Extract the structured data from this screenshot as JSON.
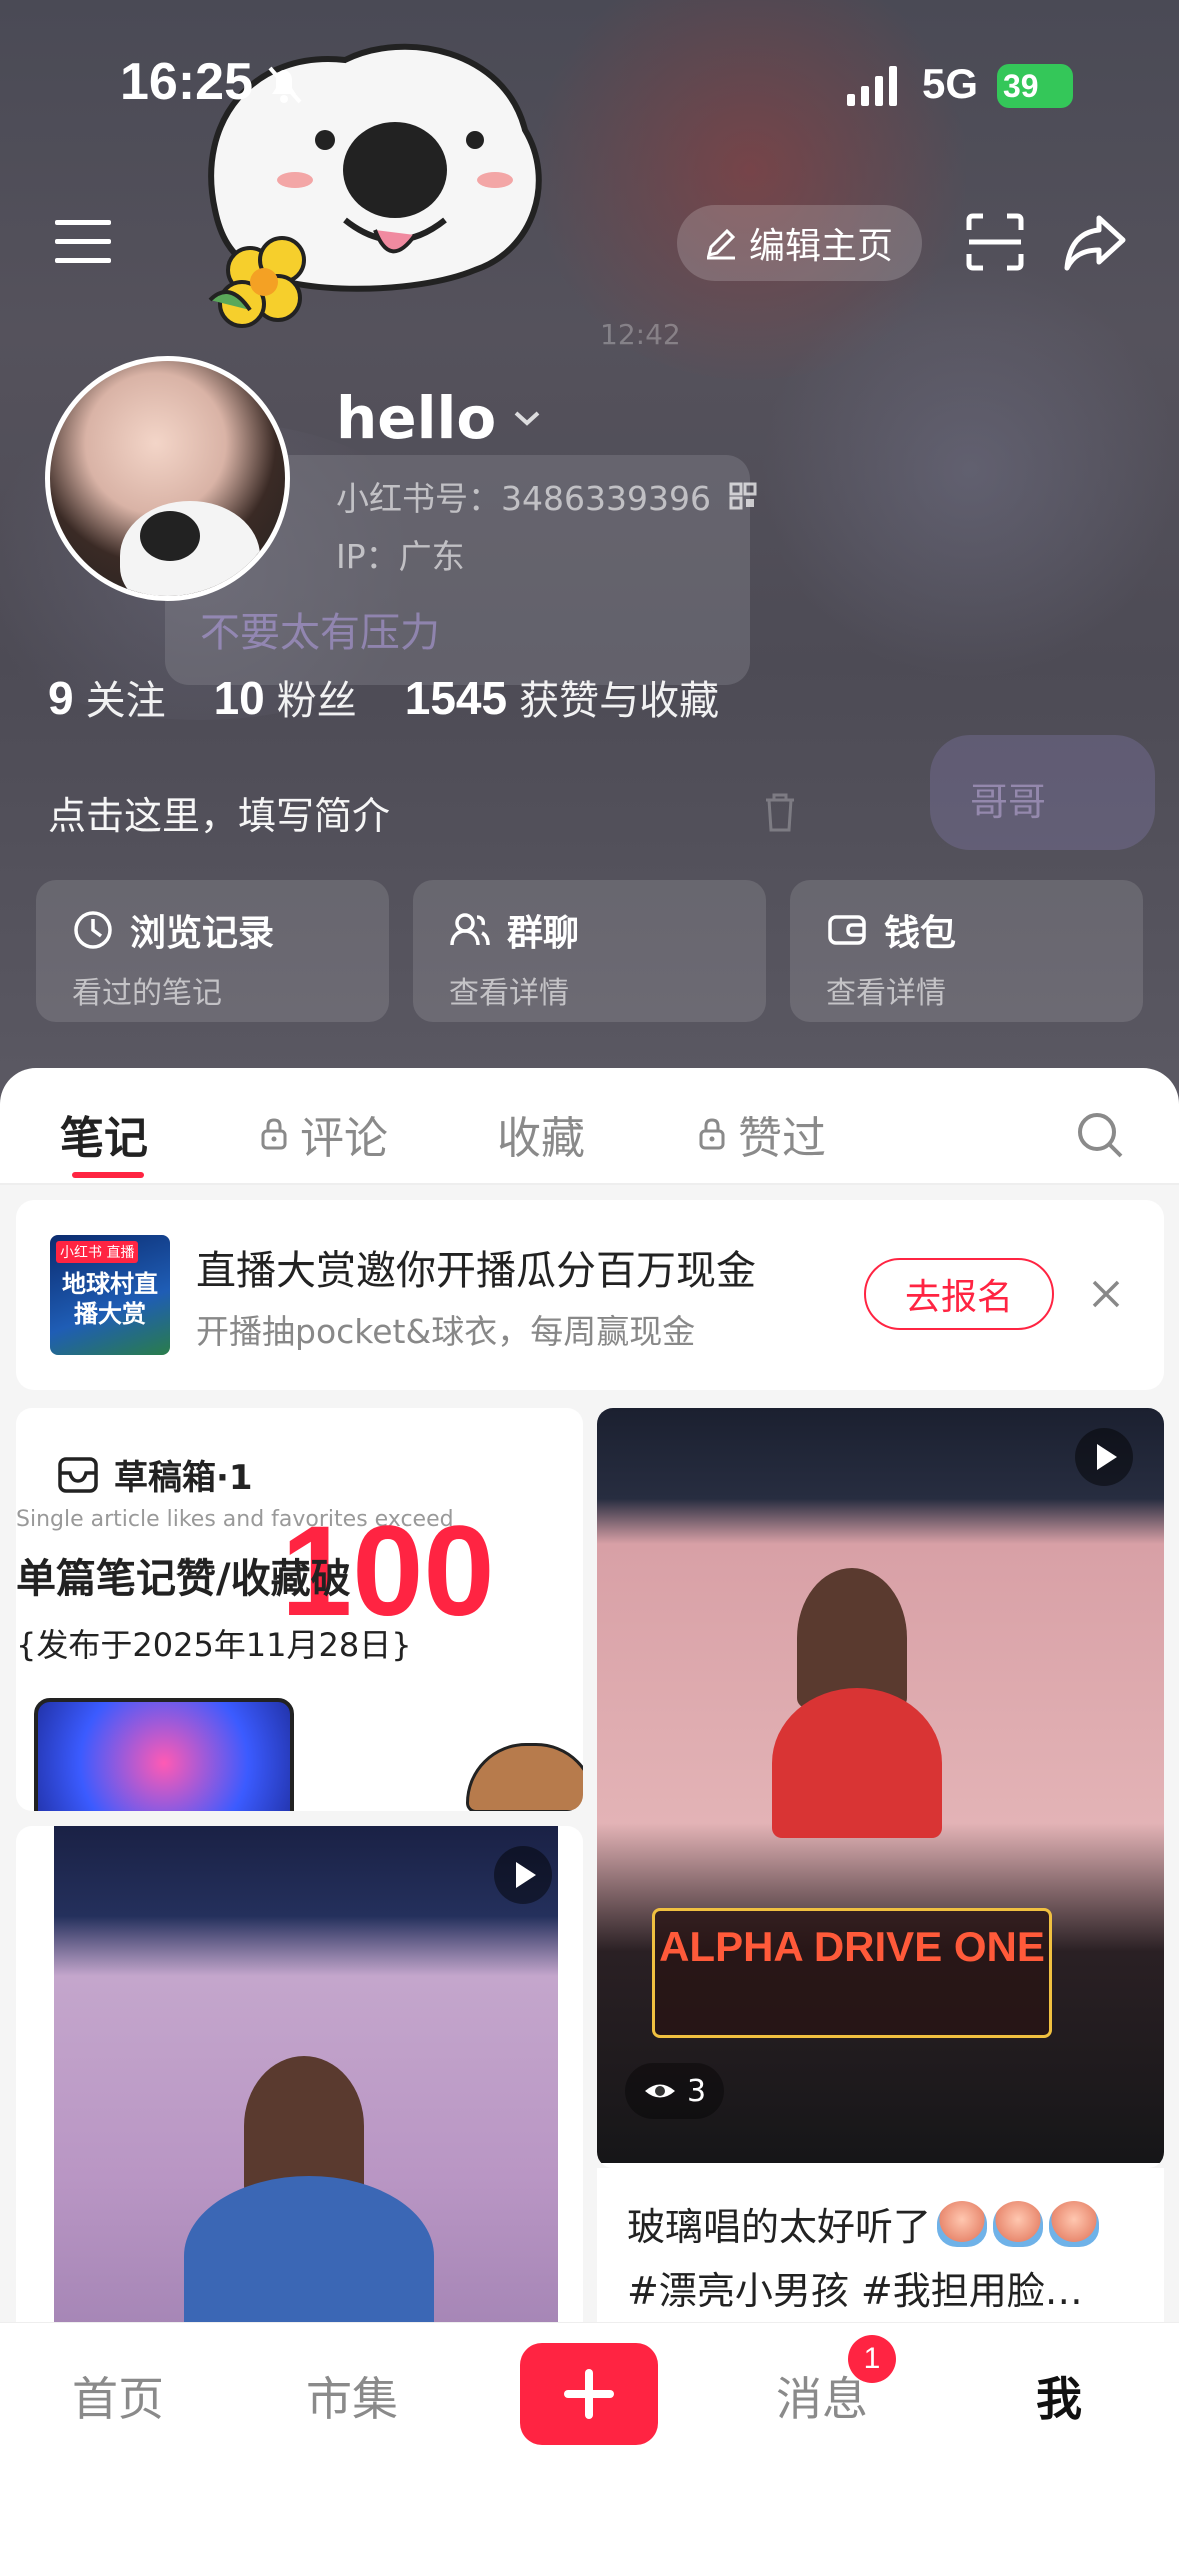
{
  "status_bar": {
    "time": "16:25",
    "network": "5G",
    "battery": "39"
  },
  "header": {
    "edit_label": "编辑主页"
  },
  "profile": {
    "username": "hello",
    "red_id": "小红书号：3486339396",
    "ip": "IP：广东",
    "stats": [
      {
        "num": "9",
        "label": "关注"
      },
      {
        "num": "10",
        "label": "粉丝"
      },
      {
        "num": "1545",
        "label": "获赞与收藏"
      }
    ],
    "bio_prompt": "点击这里，填写简介"
  },
  "background_text": {
    "chat_line": "不要太有压力",
    "chat_time": "12:42",
    "chat_bubble": "哥哥"
  },
  "quick_cards": [
    {
      "title": "浏览记录",
      "sub": "看过的笔记",
      "icon": "clock-icon"
    },
    {
      "title": "群聊",
      "sub": "查看详情",
      "icon": "group-icon"
    },
    {
      "title": "钱包",
      "sub": "查看详情",
      "icon": "wallet-icon"
    }
  ],
  "tabs": [
    {
      "label": "笔记",
      "locked": false,
      "active": true
    },
    {
      "label": "评论",
      "locked": true,
      "active": false
    },
    {
      "label": "收藏",
      "locked": false,
      "active": false
    },
    {
      "label": "赞过",
      "locked": true,
      "active": false
    }
  ],
  "promo": {
    "thumb_tag": "小红书 直播",
    "thumb_title": "地球村直播大赏",
    "title": "直播大赏邀你开播瓜分百万现金",
    "sub": "开播抽pocket&球衣，每周赢现金",
    "join_label": "去报名"
  },
  "draft": {
    "label": "草稿箱·1",
    "ghost": "Single article likes and favorites exceed",
    "big_number": "100",
    "line1": "单篇笔记赞/收藏破",
    "line2": "{发布于2025年11月28日}"
  },
  "right_post": {
    "banner": "ALPHA DRIVE ONE",
    "views": "3",
    "caption_line1": "玻璃唱的太好听了",
    "caption_line2": "#漂亮小男孩 #我担用脸…"
  },
  "bottom_nav": {
    "items": [
      "首页",
      "市集",
      "消息",
      "我"
    ],
    "badge": "1"
  },
  "colors": {
    "accent": "#ff2442",
    "battery": "#34c759"
  }
}
